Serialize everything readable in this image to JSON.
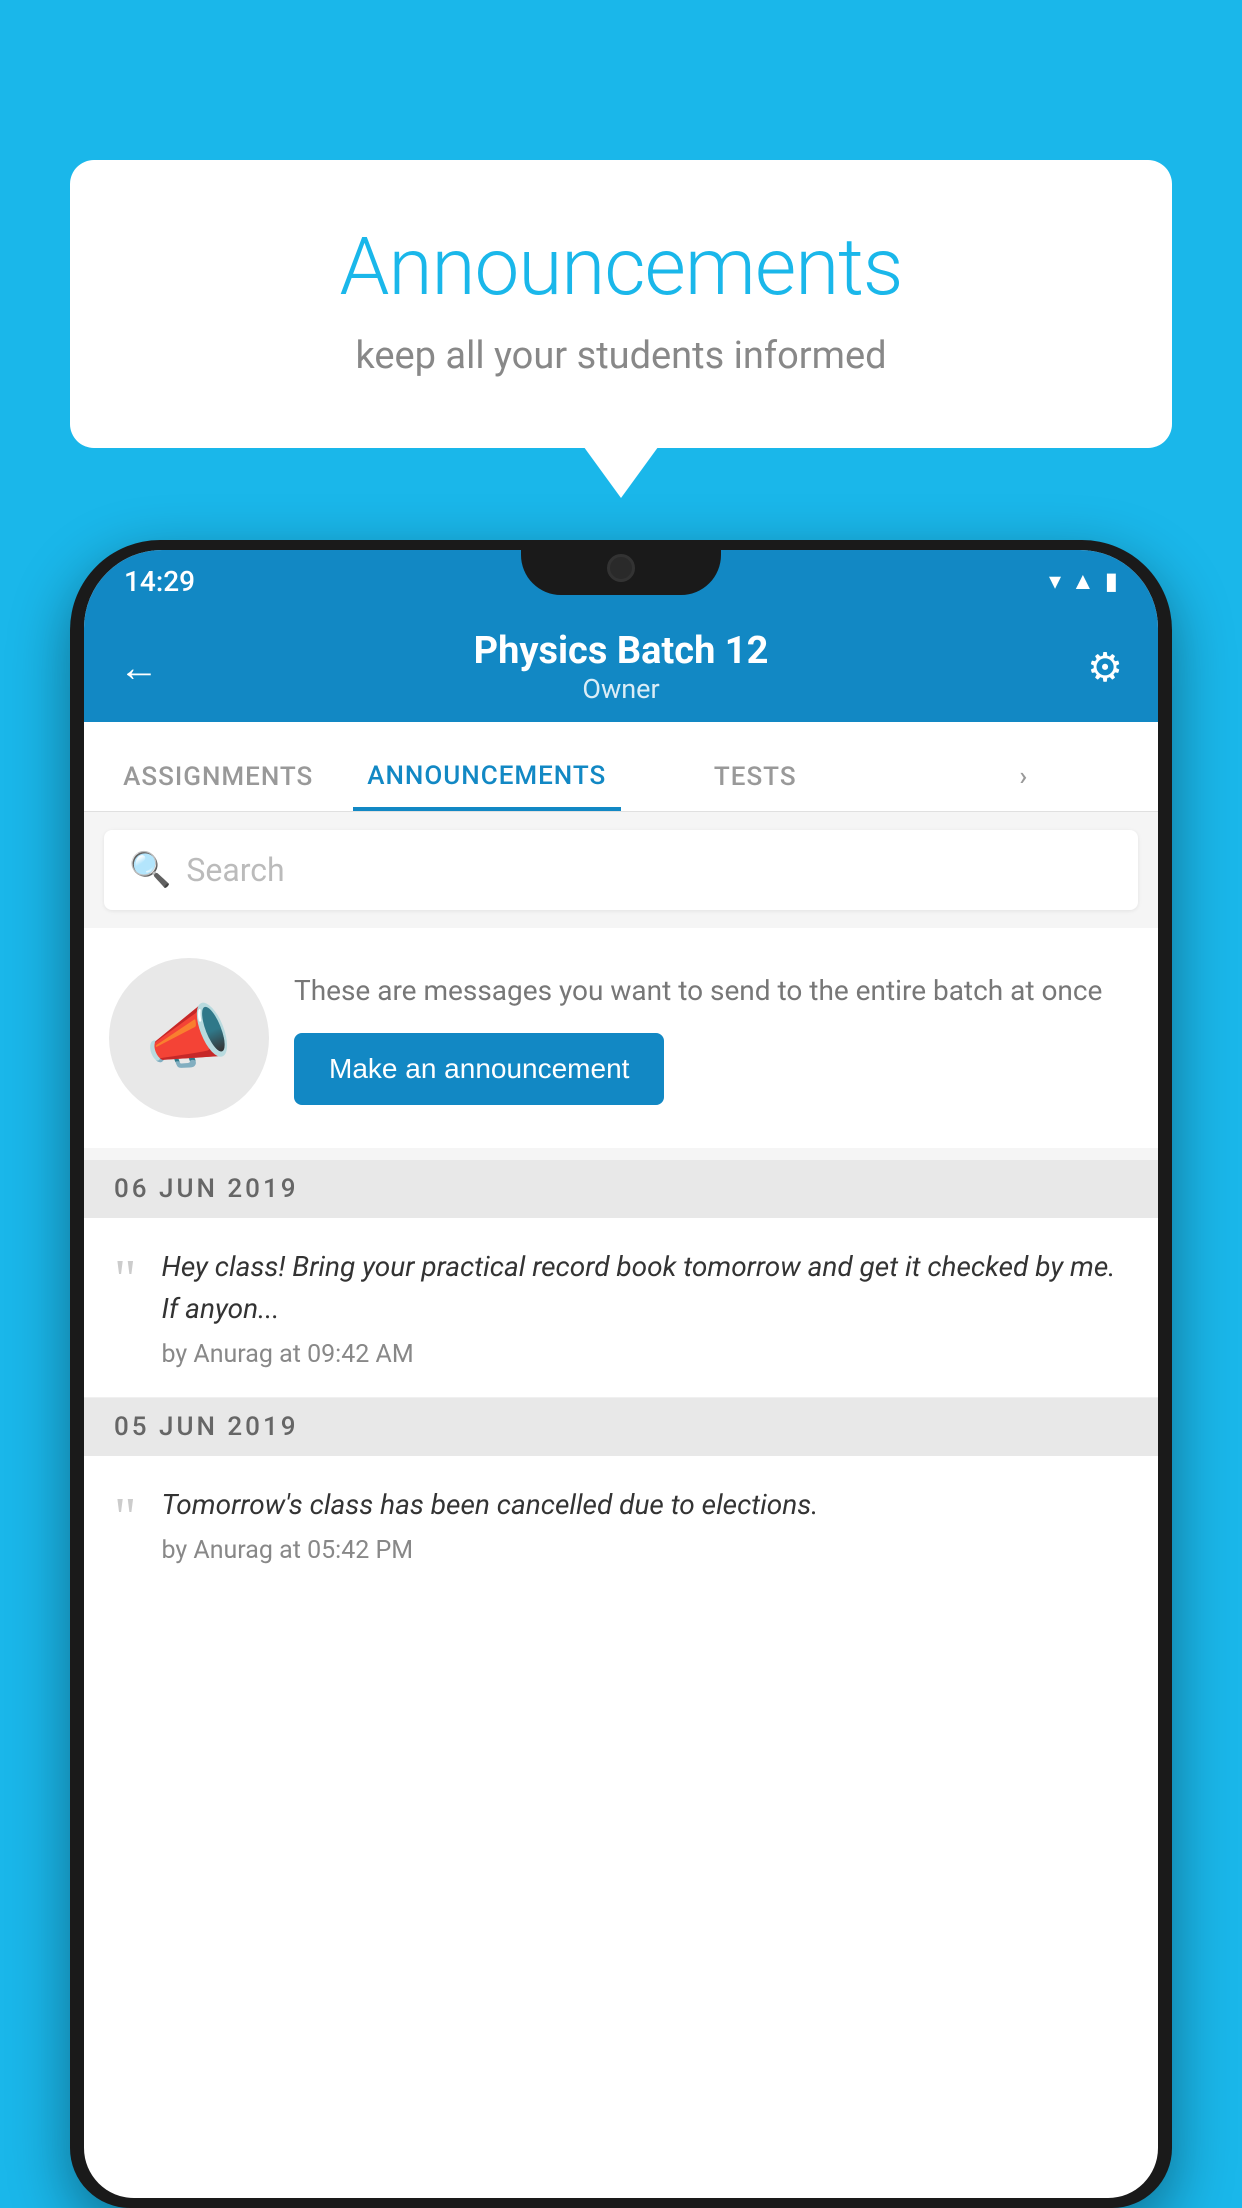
{
  "background_color": "#1ab7ea",
  "speech_bubble": {
    "title": "Announcements",
    "subtitle": "keep all your students informed"
  },
  "phone": {
    "status_bar": {
      "time": "14:29",
      "icons": [
        "wifi",
        "signal",
        "battery"
      ]
    },
    "nav": {
      "title": "Physics Batch 12",
      "subtitle": "Owner"
    },
    "tabs": [
      {
        "label": "ASSIGNMENTS",
        "active": false
      },
      {
        "label": "ANNOUNCEMENTS",
        "active": true
      },
      {
        "label": "TESTS",
        "active": false
      },
      {
        "label": "...",
        "active": false
      }
    ],
    "search": {
      "placeholder": "Search"
    },
    "promo": {
      "description": "These are messages you want to send to the entire batch at once",
      "button_label": "Make an announcement"
    },
    "announcements": [
      {
        "date": "06  JUN  2019",
        "body": "Hey class! Bring your practical record book tomorrow and get it checked by me. If anyon...",
        "meta": "by Anurag at 09:42 AM"
      },
      {
        "date": "05  JUN  2019",
        "body": "Tomorrow's class has been cancelled due to elections.",
        "meta": "by Anurag at 05:42 PM"
      }
    ]
  }
}
